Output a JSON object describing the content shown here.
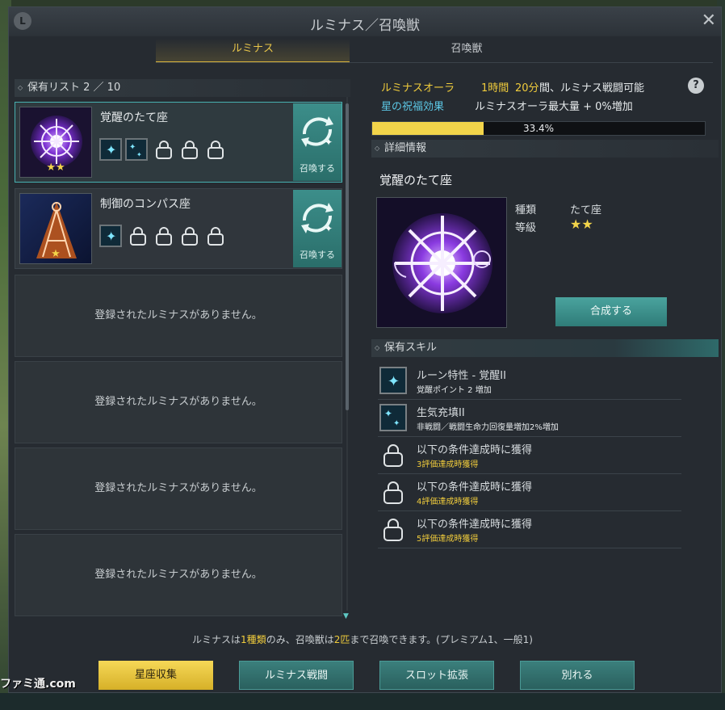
{
  "window": {
    "title": "ルミナス／召喚獣",
    "badge": "L",
    "close": "✕"
  },
  "tabs": [
    {
      "label": "ルミナス",
      "active": true
    },
    {
      "label": "召喚獣",
      "active": false
    }
  ],
  "list": {
    "header": "保有リスト 2 ／ 10",
    "entries": [
      {
        "name": "覚醒のたて座",
        "stars": 2,
        "summon_label": "召喚する",
        "skills_unlocked": 2,
        "skills_locked": 3
      },
      {
        "name": "制御のコンパス座",
        "stars": 1,
        "summon_label": "召喚する",
        "skills_unlocked": 1,
        "skills_locked": 4
      }
    ],
    "empty_text": "登録されたルミナスがありません。"
  },
  "aura": {
    "label": "ルミナスオーラ",
    "time_hours": "1時間",
    "time_minutes": "20分",
    "time_suffix": "間、ルミナス戦闘可能",
    "blessing_label": "星の祝福効果",
    "blessing_text": "ルミナスオーラ最大量 + 0%増加",
    "progress_text": "33.4%",
    "progress_value": 0.334,
    "help": "?"
  },
  "detail": {
    "header": "詳細情報",
    "name": "覚醒のたて座",
    "type_label": "種類",
    "type_value": "たて座",
    "grade_label": "等級",
    "grade_stars": 2,
    "fuse_label": "合成する"
  },
  "skills": {
    "header": "保有スキル",
    "items": [
      {
        "name": "ルーン特性 - 覚醒II",
        "desc": "覚醒ポイント 2 増加",
        "locked": false
      },
      {
        "name": "生気充填II",
        "desc": "非戦闘／戦闘生命力回復量増加2%増加",
        "locked": false
      },
      {
        "name": "以下の条件達成時に獲得",
        "desc": "3評価達成時獲得",
        "locked": true
      },
      {
        "name": "以下の条件達成時に獲得",
        "desc": "4評価達成時獲得",
        "locked": true
      },
      {
        "name": "以下の条件達成時に獲得",
        "desc": "5評価達成時獲得",
        "locked": true
      }
    ]
  },
  "footnote": {
    "p1": "ルミナスは",
    "h1": "1種類",
    "p2": "のみ、召喚獣は",
    "h2": "2匹",
    "p3": "まで召喚できます。(プレミアム1、一般1)"
  },
  "buttons": {
    "collect": "星座収集",
    "battle": "ルミナス戦闘",
    "expand": "スロット拡張",
    "part": "別れる"
  },
  "watermark": "ファミ通.com",
  "colors": {
    "accent_yellow": "#f0cc3c",
    "accent_teal": "#3b8d89",
    "panel": "#262b31"
  }
}
